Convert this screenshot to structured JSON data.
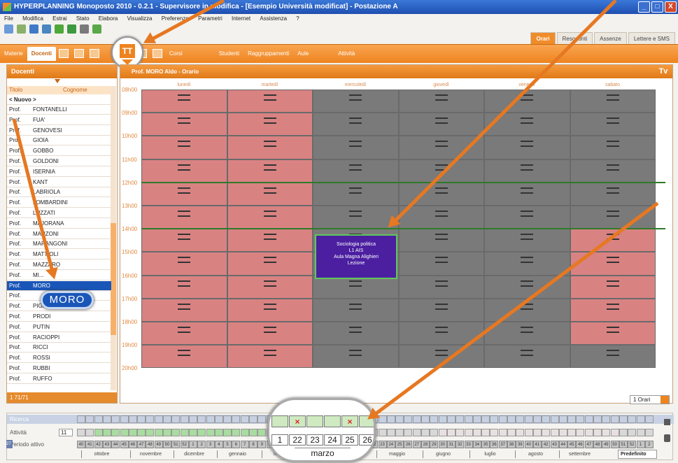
{
  "window": {
    "title": "HYPERPLANNING Monoposto 2010 - 0.2.1 - Supervisore in modifica - [Esempio Università modificat] - Postazione A",
    "min": "_",
    "max": "□",
    "close": "X"
  },
  "menu": [
    "File",
    "Modifica",
    "Estrai",
    "Stato",
    "Elabora",
    "Visualizza",
    "Preferenze",
    "Parametri",
    "Internet",
    "Assistenza",
    "?"
  ],
  "top_tabs": [
    "Orari",
    "Resoconti",
    "Assenze",
    "Lettere e SMS"
  ],
  "sub_tabs": {
    "materie": "Materie",
    "docenti": "Docenti",
    "corsi": "Corsi",
    "studenti": "Studenti",
    "raggruppamenti": "Raggruppamenti",
    "aule": "Aule",
    "attivita": "Attività"
  },
  "left_panel": {
    "title": "Docenti",
    "col_titolo": "Titolo",
    "col_cognome": "Cognome",
    "new_entry": "< Nuovo >",
    "rows": [
      {
        "t": "Prof.",
        "n": "FONTANELLI"
      },
      {
        "t": "Prof.",
        "n": "FUA'"
      },
      {
        "t": "Prof.",
        "n": "GENOVESI"
      },
      {
        "t": "Prof.",
        "n": "GIOIA"
      },
      {
        "t": "Prof.",
        "n": "GOBBO"
      },
      {
        "t": "Prof.",
        "n": "GOLDONI"
      },
      {
        "t": "Prof.",
        "n": "ISERNIA"
      },
      {
        "t": "Prof.",
        "n": "KANT"
      },
      {
        "t": "Prof.",
        "n": "LABRIOLA"
      },
      {
        "t": "Prof.",
        "n": "LOMBARDINI"
      },
      {
        "t": "Prof.",
        "n": "LUZZATI"
      },
      {
        "t": "Prof.",
        "n": "MAJORANA"
      },
      {
        "t": "Prof.",
        "n": "MANZONI"
      },
      {
        "t": "Prof.",
        "n": "MARANGONI"
      },
      {
        "t": "Prof.",
        "n": "MATTIOLI"
      },
      {
        "t": "Prof.",
        "n": "MAZZARO"
      },
      {
        "t": "Prof.",
        "n": "MI..."
      },
      {
        "t": "Prof.",
        "n": "MORO"
      },
      {
        "t": "Prof.",
        "n": ""
      },
      {
        "t": "Prof.",
        "n": "PIGA"
      },
      {
        "t": "Prof.",
        "n": "PRODI"
      },
      {
        "t": "Prof.",
        "n": "PUTIN"
      },
      {
        "t": "Prof.",
        "n": "RACIOPPI"
      },
      {
        "t": "Prof.",
        "n": "RICCI"
      },
      {
        "t": "Prof.",
        "n": "ROSSI"
      },
      {
        "t": "Prof.",
        "n": "RUBBI"
      },
      {
        "t": "Prof.",
        "n": "RUFFO"
      }
    ],
    "magnified": "MORO",
    "footer": "1  71/71"
  },
  "schedule": {
    "header": "Prof. MORO Aldo - Orario",
    "days": [
      "lunedì",
      "martedì",
      "mercoledì",
      "giovedì",
      "venerdì",
      "sabato"
    ],
    "hours": [
      "08h00",
      "09h00",
      "10h00",
      "11h00",
      "12h00",
      "13h00",
      "14h00",
      "15h00",
      "16h00",
      "17h00",
      "18h00",
      "19h00",
      "20h00"
    ],
    "course": {
      "line1": "Sociologia politica",
      "line2": "L1 AIS",
      "line3": "Aula Magna Alighieri",
      "line4": "Lezione"
    },
    "colors": {
      "unavailable": "#d98282",
      "free": "#7a7a7a",
      "course": "#4b1fa0",
      "accent": "#ee8420"
    }
  },
  "hours_select": "1 Orari",
  "bottom": {
    "row1": "Ricerca",
    "row2_label": "Attività",
    "row2_value": "11",
    "row3_label": "Periodo attivo",
    "row3_num": "27",
    "months": [
      "ottobre",
      "novembre",
      "dicembre",
      "gennaio",
      "febbraio",
      "marzo",
      "maggio",
      "giugno",
      "luglio",
      "agosto",
      "settembre"
    ],
    "zoom_dates": [
      "1",
      "22",
      "23",
      "24",
      "25",
      "26"
    ],
    "zoom_month": "marzo",
    "predefinito": "Predefinito"
  }
}
